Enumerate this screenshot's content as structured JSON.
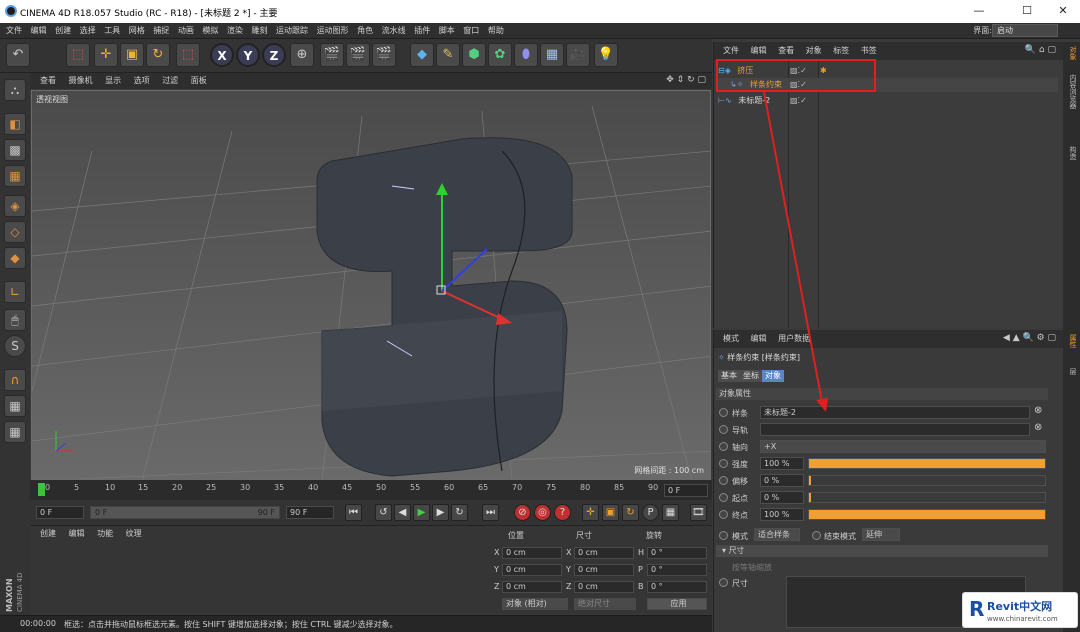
{
  "window": {
    "title": "CINEMA 4D R18.057 Studio (RC - R18) - [未标题 2 *] - 主要",
    "minimize": "—",
    "maximize": "☐",
    "close": "✕"
  },
  "menubar": {
    "items": [
      "文件",
      "编辑",
      "创建",
      "选择",
      "工具",
      "网格",
      "捕捉",
      "动画",
      "模拟",
      "渲染",
      "雕刻",
      "运动跟踪",
      "运动图形",
      "角色",
      "流水线",
      "插件",
      "脚本",
      "窗口",
      "帮助"
    ],
    "layout_label": "界面:",
    "layout_value": "启动"
  },
  "toolbar": {
    "axis_x": "X",
    "axis_y": "Y",
    "axis_z": "Z"
  },
  "viewport": {
    "menu": [
      "查看",
      "摄像机",
      "显示",
      "选项",
      "过滤",
      "面板"
    ],
    "label": "透视视图",
    "grid_spacing": "网格间距 : 100 cm"
  },
  "timeline": {
    "ticks": [
      "0",
      "5",
      "10",
      "15",
      "20",
      "25",
      "30",
      "35",
      "40",
      "45",
      "50",
      "55",
      "60",
      "65",
      "70",
      "75",
      "80",
      "85",
      "90"
    ],
    "current_frame": "0 F",
    "start_frame": "0 F",
    "range_start": "0 F",
    "range_end": "90 F",
    "end_frame": "90 F"
  },
  "materials": {
    "menu": [
      "创建",
      "编辑",
      "功能",
      "纹理"
    ]
  },
  "brand": {
    "maxon": "MAXON",
    "cinema": "CINEMA 4D"
  },
  "coords": {
    "position_header": "位置",
    "size_header": "尺寸",
    "rotation_header": "旋转",
    "rows": [
      {
        "axis": "X",
        "pos": "0 cm",
        "size_axis": "X",
        "size": "0 cm",
        "rot_axis": "H",
        "rot": "0 °"
      },
      {
        "axis": "Y",
        "pos": "0 cm",
        "size_axis": "Y",
        "size": "0 cm",
        "rot_axis": "P",
        "rot": "0 °"
      },
      {
        "axis": "Z",
        "pos": "0 cm",
        "size_axis": "Z",
        "size": "0 cm",
        "rot_axis": "B",
        "rot": "0 °"
      }
    ],
    "mode_select": "对象 (相对)",
    "size_select": "绝对尺寸",
    "apply": "应用"
  },
  "status": {
    "time": "00:00:00",
    "message": "框选：点击并拖动鼠标框选元素。按住 SHIFT 键增加选择对象；按住 CTRL 键减少选择对象。"
  },
  "object_manager": {
    "menu": [
      "文件",
      "编辑",
      "查看",
      "对象",
      "标签",
      "书签"
    ],
    "objects": [
      {
        "name": "挤压",
        "color": "#e6a23c"
      },
      {
        "name": "样条约束",
        "color": "#e6a23c"
      },
      {
        "name": "未标题-2",
        "color": "#d8d8d8"
      }
    ]
  },
  "attribute_manager": {
    "menu": [
      "模式",
      "编辑",
      "用户数据"
    ],
    "object_title": "样条约束 [样条约束]",
    "tabs": [
      "基本",
      "坐标",
      "对象"
    ],
    "section": "对象属性",
    "spline_label": "样条",
    "spline_value": "未标题-2",
    "rail_label": "导轨",
    "axis_label": "轴向",
    "axis_value": "+X",
    "strength_label": "强度",
    "strength_value": "100 %",
    "strength": 1.0,
    "offset_label": "偏移",
    "offset_value": "0 %",
    "offset": 0.0,
    "start_label": "起点",
    "start_value": "0 %",
    "start": 0.0,
    "end_label": "终点",
    "end_value": "100 %",
    "end": 1.0,
    "mode_label": "模式",
    "mode_value": "适合样条",
    "end_mode_label": "结束模式",
    "end_mode_value": "延伸",
    "size_section": "尺寸",
    "use_spline_label": "按等轴缩放",
    "size_label": "尺寸"
  },
  "side_tabs": [
    "对象",
    "内容浏览器",
    "构造",
    "属性",
    "层"
  ],
  "watermark": {
    "brand": "Revit中文网",
    "url": "www.chinarevit.com"
  }
}
